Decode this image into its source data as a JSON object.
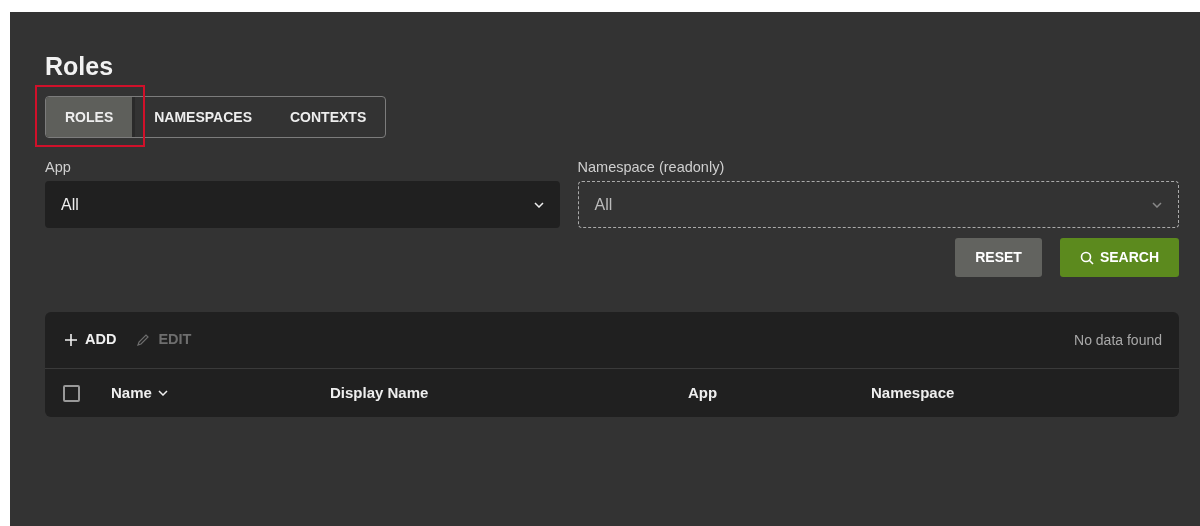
{
  "title": "Roles",
  "tabs": [
    {
      "label": "ROLES",
      "selected": true,
      "highlighted": true
    },
    {
      "label": "NAMESPACES",
      "selected": false,
      "highlighted": false
    },
    {
      "label": "CONTEXTS",
      "selected": false,
      "highlighted": false
    }
  ],
  "filters": [
    {
      "label": "App",
      "value": "All",
      "readonly": false
    },
    {
      "label": "Namespace (readonly)",
      "value": "All",
      "readonly": true
    }
  ],
  "buttons": [
    {
      "label": "RESET",
      "kind": "reset"
    },
    {
      "label": "SEARCH",
      "kind": "search"
    }
  ],
  "toolbar": {
    "actions": [
      {
        "label": "ADD",
        "kind": "add",
        "disabled": false
      },
      {
        "label": "EDIT",
        "kind": "edit",
        "disabled": true
      }
    ],
    "status": "No data found"
  },
  "table": {
    "select_all_checked": false,
    "columns": [
      {
        "label": "Name",
        "sorted": true
      },
      {
        "label": "Display Name",
        "sorted": false
      },
      {
        "label": "App",
        "sorted": false
      },
      {
        "label": "Namespace",
        "sorted": false
      }
    ]
  }
}
